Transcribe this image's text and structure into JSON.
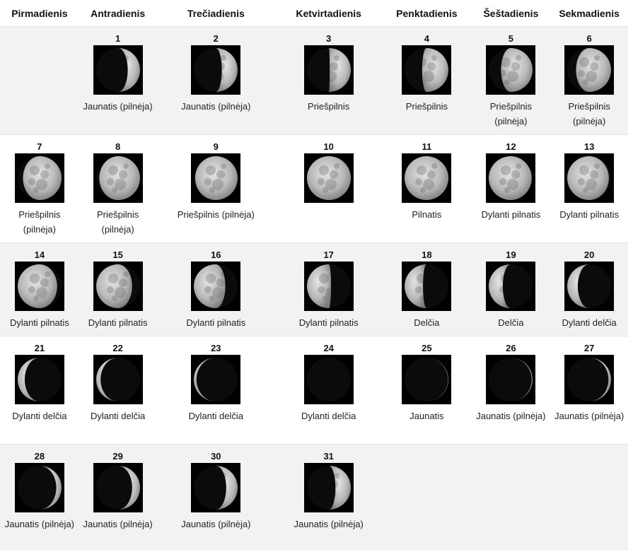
{
  "weekdays": [
    "Pirmadienis",
    "Antradienis",
    "Trečiadienis",
    "Ketvirtadienis",
    "Penktadienis",
    "Šeštadienis",
    "Sekmadienis"
  ],
  "weeks": [
    [
      null,
      {
        "day": "1",
        "phase": "Jaunatis (pilnėja)",
        "illum": 0.28,
        "side": "right"
      },
      {
        "day": "2",
        "phase": "Jaunatis (pilnėja)",
        "illum": 0.36,
        "side": "right"
      },
      {
        "day": "3",
        "phase": "Priešpilnis",
        "illum": 0.48,
        "side": "right"
      },
      {
        "day": "4",
        "phase": "Priešpilnis",
        "illum": 0.6,
        "side": "right"
      },
      {
        "day": "5",
        "phase": "Priešpilnis (pilnėja)",
        "illum": 0.72,
        "side": "right"
      },
      {
        "day": "6",
        "phase": "Priešpilnis (pilnėja)",
        "illum": 0.8,
        "side": "right"
      }
    ],
    [
      {
        "day": "7",
        "phase": "Priešpilnis (pilnėja)",
        "illum": 0.88,
        "side": "right"
      },
      {
        "day": "8",
        "phase": "Priešpilnis (pilnėja)",
        "illum": 0.93,
        "side": "right"
      },
      {
        "day": "9",
        "phase": "Priešpilnis (pilnėja)",
        "illum": 0.97,
        "side": "right"
      },
      {
        "day": "10",
        "phase": "",
        "illum": 1.0,
        "side": "right"
      },
      {
        "day": "11",
        "phase": "Pilnatis",
        "illum": 1.0,
        "side": "left"
      },
      {
        "day": "12",
        "phase": "Dylanti pilnatis",
        "illum": 0.98,
        "side": "left"
      },
      {
        "day": "13",
        "phase": "Dylanti pilnatis",
        "illum": 0.95,
        "side": "left"
      }
    ],
    [
      {
        "day": "14",
        "phase": "Dylanti pilnatis",
        "illum": 0.9,
        "side": "left"
      },
      {
        "day": "15",
        "phase": "Dylanti pilnatis",
        "illum": 0.82,
        "side": "left"
      },
      {
        "day": "16",
        "phase": "Dylanti pilnatis",
        "illum": 0.72,
        "side": "left"
      },
      {
        "day": "17",
        "phase": "Dylanti pilnatis",
        "illum": 0.55,
        "side": "left"
      },
      {
        "day": "18",
        "phase": "Delčia",
        "illum": 0.42,
        "side": "left"
      },
      {
        "day": "19",
        "phase": "Delčia",
        "illum": 0.32,
        "side": "left"
      },
      {
        "day": "20",
        "phase": "Dylanti delčia",
        "illum": 0.24,
        "side": "left"
      }
    ],
    [
      {
        "day": "21",
        "phase": "Dylanti delčia",
        "illum": 0.16,
        "side": "left"
      },
      {
        "day": "22",
        "phase": "Dylanti delčia",
        "illum": 0.1,
        "side": "left"
      },
      {
        "day": "23",
        "phase": "Dylanti delčia",
        "illum": 0.06,
        "side": "left"
      },
      {
        "day": "24",
        "phase": "Dylanti delčia",
        "illum": 0.0,
        "side": "left"
      },
      {
        "day": "25",
        "phase": "Jaunatis",
        "illum": 0.01,
        "side": "right"
      },
      {
        "day": "26",
        "phase": "Jaunatis (pilnėja)",
        "illum": 0.02,
        "side": "right"
      },
      {
        "day": "27",
        "phase": "Jaunatis (pilnėja)",
        "illum": 0.06,
        "side": "right"
      }
    ],
    [
      {
        "day": "28",
        "phase": "Jaunatis (pilnėja)",
        "illum": 0.12,
        "side": "right"
      },
      {
        "day": "29",
        "phase": "Jaunatis (pilnėja)",
        "illum": 0.18,
        "side": "right"
      },
      {
        "day": "30",
        "phase": "Jaunatis (pilnėja)",
        "illum": 0.26,
        "side": "right"
      },
      {
        "day": "31",
        "phase": "Jaunatis (pilnėja)",
        "illum": 0.35,
        "side": "right"
      },
      null,
      null,
      null
    ]
  ]
}
